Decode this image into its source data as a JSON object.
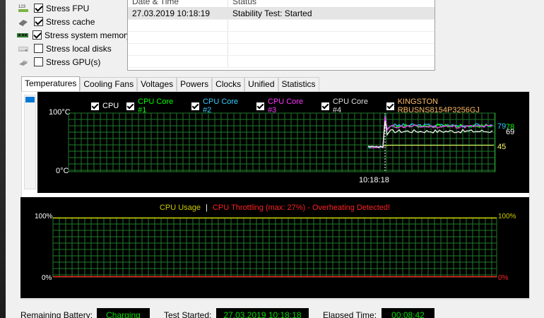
{
  "stress_options": [
    {
      "label": "Stress FPU",
      "checked": true,
      "icon": "fpu-icon"
    },
    {
      "label": "Stress cache",
      "checked": true,
      "icon": "cache-icon"
    },
    {
      "label": "Stress system memory",
      "checked": true,
      "icon": "memory-icon"
    },
    {
      "label": "Stress local disks",
      "checked": false,
      "icon": "disk-icon"
    },
    {
      "label": "Stress GPU(s)",
      "checked": false,
      "icon": "gpu-icon"
    }
  ],
  "log": {
    "headers": [
      "Date & Time",
      "Status"
    ],
    "rows": [
      {
        "datetime": "27.03.2019 10:18:19",
        "status": "Stability Test: Started"
      }
    ]
  },
  "tabs": [
    {
      "label": "Temperatures",
      "active": true
    },
    {
      "label": "Cooling Fans",
      "active": false
    },
    {
      "label": "Voltages",
      "active": false
    },
    {
      "label": "Powers",
      "active": false
    },
    {
      "label": "Clocks",
      "active": false
    },
    {
      "label": "Unified",
      "active": false
    },
    {
      "label": "Statistics",
      "active": false
    }
  ],
  "temperature_chart": {
    "legend": [
      {
        "label": "CPU",
        "color": "#ffffff"
      },
      {
        "label": "CPU Core #1",
        "color": "#00ff00"
      },
      {
        "label": "CPU Core #2",
        "color": "#33ccff"
      },
      {
        "label": "CPU Core #3",
        "color": "#ff33ff"
      },
      {
        "label": "CPU Core #4",
        "color": "#dddddd"
      },
      {
        "label": "KINGSTON RBUSNS8154P3256GJ",
        "color": "#ffbb66"
      }
    ],
    "y_max_label": "100°C",
    "y_min_label": "0°C",
    "x_label": "10:18:18",
    "current_values": [
      {
        "value": "79",
        "color": "#33ccff"
      },
      {
        "value": "78",
        "color": "#00ff00"
      },
      {
        "value": "69",
        "color": "#ffffff"
      },
      {
        "value": "45",
        "color": "#ffff66"
      }
    ]
  },
  "usage_chart": {
    "title_usage": "CPU Usage",
    "separator": "|",
    "title_throttle": "CPU Throttling (max: 27%) - Overheating Detected!",
    "usage_color": "#cccc00",
    "throttle_color": "#ff2222",
    "left_top": "100%",
    "left_bottom": "0%",
    "right_top": "100%",
    "right_bottom": "0%"
  },
  "status_bar": {
    "battery_label": "Remaining Battery:",
    "battery_value": "Charging",
    "started_label": "Test Started:",
    "started_value": "27.03.2019 10:18:18",
    "elapsed_label": "Elapsed Time:",
    "elapsed_value": "00:08:42"
  },
  "chart_data": [
    {
      "type": "line",
      "title": "",
      "ylabel": "",
      "xlabel": "",
      "ylim": [
        0,
        100
      ],
      "x_tick": "10:18:18",
      "legend_placement": "top",
      "grid": true,
      "series": [
        {
          "name": "CPU",
          "current": 69
        },
        {
          "name": "CPU Core #1",
          "current": 78
        },
        {
          "name": "CPU Core #2",
          "current": 79
        },
        {
          "name": "KINGSTON RBUSNS8154P3256GJ",
          "current": 45
        }
      ]
    },
    {
      "type": "line",
      "title": "CPU Usage | CPU Throttling (max: 27%) - Overheating Detected!",
      "ylim": [
        0,
        100
      ],
      "grid": true,
      "series": [
        {
          "name": "CPU Usage",
          "values": [
            100,
            100
          ]
        },
        {
          "name": "CPU Throttling",
          "values": [
            0,
            0
          ]
        }
      ]
    }
  ]
}
